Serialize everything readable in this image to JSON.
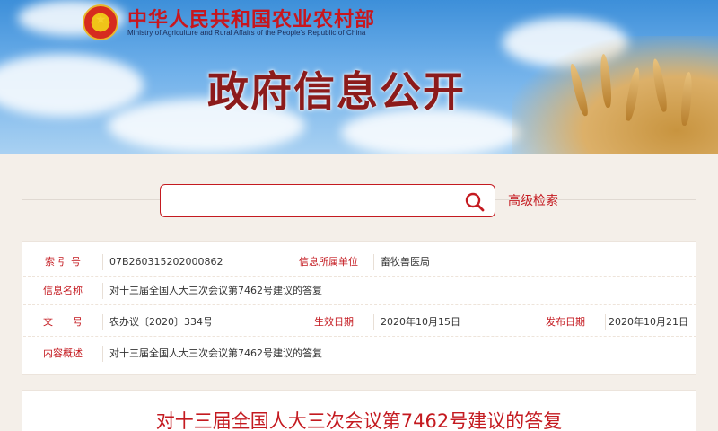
{
  "header": {
    "ministry_cn": "中华人民共和国农业农村部",
    "ministry_en": "Ministry of Agriculture and Rural Affairs of the People's Republic of China",
    "banner_title": "政府信息公开",
    "emblem_icon": "national-emblem-icon"
  },
  "search": {
    "value": "",
    "placeholder": "",
    "advanced_label": "高级检索",
    "icon": "search-icon"
  },
  "info": {
    "index_label": "索 引 号",
    "index_value": "07B260315202000862",
    "unit_label": "信息所属单位",
    "unit_value": "畜牧兽医局",
    "name_label": "信息名称",
    "name_value": "对十三届全国人大三次会议第7462号建议的答复",
    "doc_label": "文　　号",
    "doc_value": "农办议〔2020〕334号",
    "effective_label": "生效日期",
    "effective_value": "2020年10月15日",
    "publish_label": "发布日期",
    "publish_value": "2020年10月21日",
    "summary_label": "内容概述",
    "summary_value": "对十三届全国人大三次会议第7462号建议的答复"
  },
  "document": {
    "title": "对十三届全国人大三次会议第7462号建议的答复"
  },
  "colors": {
    "accent": "#c41a20",
    "banner_blue": "#3d8fd9",
    "banner_title": "#8c1b1b"
  }
}
